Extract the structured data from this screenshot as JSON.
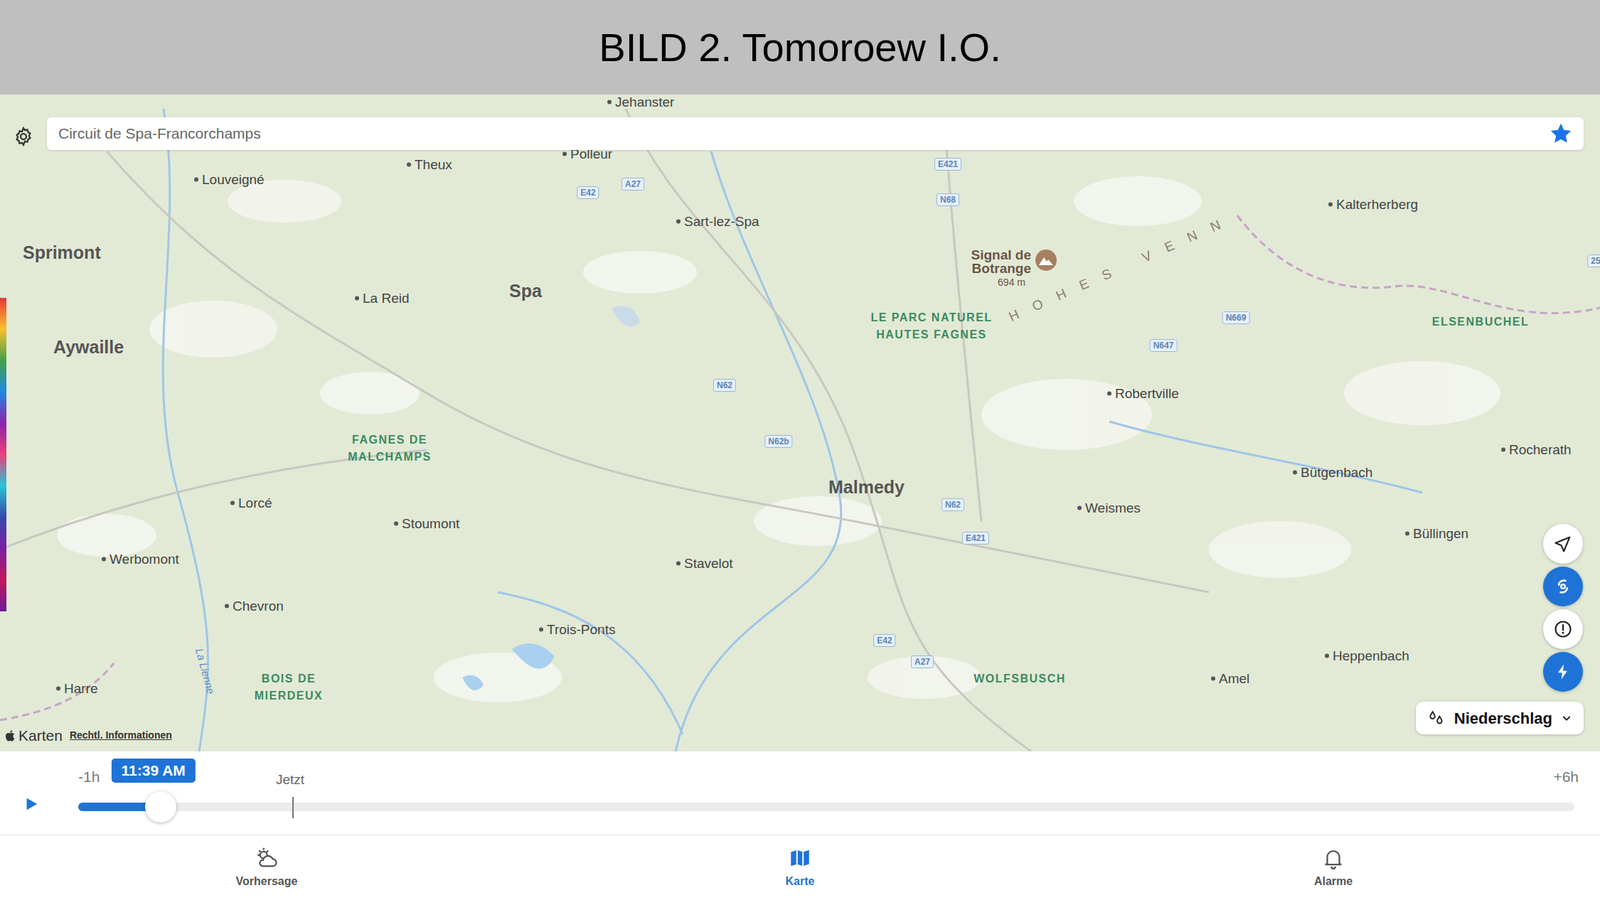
{
  "header": {
    "title": "BILD 2. Tomoroew I.O."
  },
  "search": {
    "value": "Circuit de Spa-Francorchamps",
    "favorite": true
  },
  "map": {
    "places": [
      {
        "name": "Jehanster",
        "kind": "town"
      },
      {
        "name": "Theux",
        "kind": "town"
      },
      {
        "name": "Polleur",
        "kind": "town"
      },
      {
        "name": "Louveigné",
        "kind": "town"
      },
      {
        "name": "Sart-lez-Spa",
        "kind": "town"
      },
      {
        "name": "Kalterherberg",
        "kind": "town"
      },
      {
        "name": "Sprimont",
        "kind": "city"
      },
      {
        "name": "La Reid",
        "kind": "town"
      },
      {
        "name": "Spa",
        "kind": "city"
      },
      {
        "name": "Aywaille",
        "kind": "city"
      },
      {
        "name": "Robertville",
        "kind": "town"
      },
      {
        "name": "Rocherath",
        "kind": "town"
      },
      {
        "name": "Bütgenbach",
        "kind": "town"
      },
      {
        "name": "Malmedy",
        "kind": "city"
      },
      {
        "name": "Weismes",
        "kind": "town"
      },
      {
        "name": "Lorcé",
        "kind": "town"
      },
      {
        "name": "Stoumont",
        "kind": "town"
      },
      {
        "name": "Büllingen",
        "kind": "town"
      },
      {
        "name": "Werbomont",
        "kind": "town"
      },
      {
        "name": "Stavelot",
        "kind": "town"
      },
      {
        "name": "Chevron",
        "kind": "town"
      },
      {
        "name": "Trois-Ponts",
        "kind": "town"
      },
      {
        "name": "Heppenbach",
        "kind": "town"
      },
      {
        "name": "Amel",
        "kind": "town"
      },
      {
        "name": "Harre",
        "kind": "town"
      },
      {
        "name": "FAGNES DE MALCHAMPS",
        "kind": "area"
      },
      {
        "name": "LE PARC NATUREL HAUTES FAGNES",
        "kind": "area"
      },
      {
        "name": "BOIS DE MIERDEUX",
        "kind": "area"
      },
      {
        "name": "WOLFSBUSCH",
        "kind": "area"
      },
      {
        "name": "ELSENBUCHEL",
        "kind": "area"
      }
    ],
    "roads": [
      "E421",
      "N68",
      "A27",
      "E42",
      "N62",
      "N62b",
      "N647",
      "N669",
      "N62",
      "E421",
      "E42",
      "A27",
      "25"
    ],
    "landmark": {
      "name": "Signal de Botrange",
      "elevation": "694 m"
    },
    "region": "HOHES VENN",
    "river": "La Lienne",
    "attribution": "Karten",
    "legal": "Rechtl. Informationen",
    "buttons": [
      {
        "active": false
      },
      {
        "active": true
      },
      {
        "active": false
      },
      {
        "active": true
      }
    ],
    "layer": "Niederschlag"
  },
  "timeline": {
    "start": "-1h",
    "time": "11:39 AM",
    "now": "Jetzt",
    "end": "+6h",
    "level": 0.055,
    "playing": false
  },
  "tabs": [
    {
      "label": "Vorhersage",
      "selected": false
    },
    {
      "label": "Karte",
      "selected": true
    },
    {
      "label": "Alarme",
      "selected": false
    }
  ]
}
